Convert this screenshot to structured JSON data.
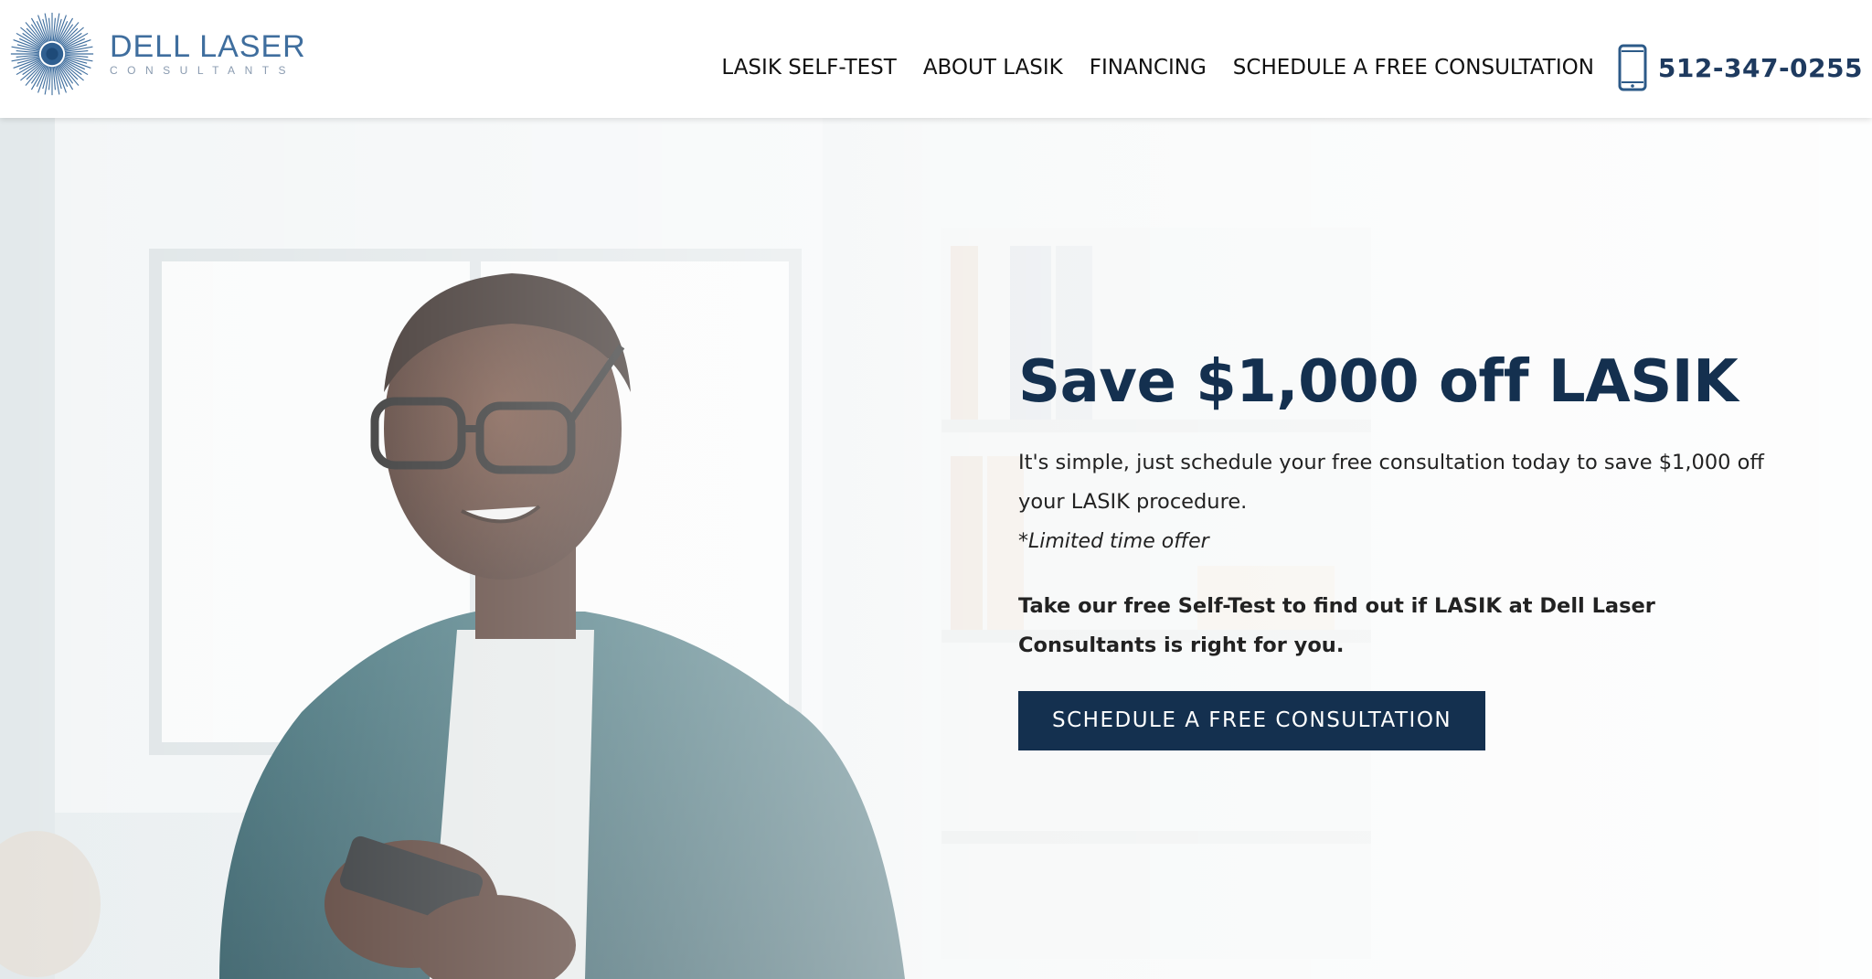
{
  "brand": {
    "name": "DELL LASER",
    "tagline": "CONSULTANTS",
    "logo_icon": "sunburst-logo-icon",
    "accent_color": "#3f6e9e"
  },
  "nav": {
    "items": [
      {
        "label": "LASIK SELF-TEST"
      },
      {
        "label": "ABOUT LASIK"
      },
      {
        "label": "FINANCING"
      },
      {
        "label": "SCHEDULE A FREE CONSULTATION"
      }
    ],
    "phone_icon": "mobile-phone-icon",
    "phone": "512-347-0255"
  },
  "hero": {
    "title": "Save $1,000 off LASIK",
    "paragraph": "It's simple, just schedule your free consultation today to save $1,000 off your LASIK procedure.",
    "note": "*Limited time offer",
    "strong": "Take our free Self-Test to find out if LASIK at Dell Laser Consultants is right for you.",
    "cta_label": "SCHEDULE A FREE CONSULTATION",
    "cta_color": "#14304f",
    "title_color": "#14304f"
  }
}
